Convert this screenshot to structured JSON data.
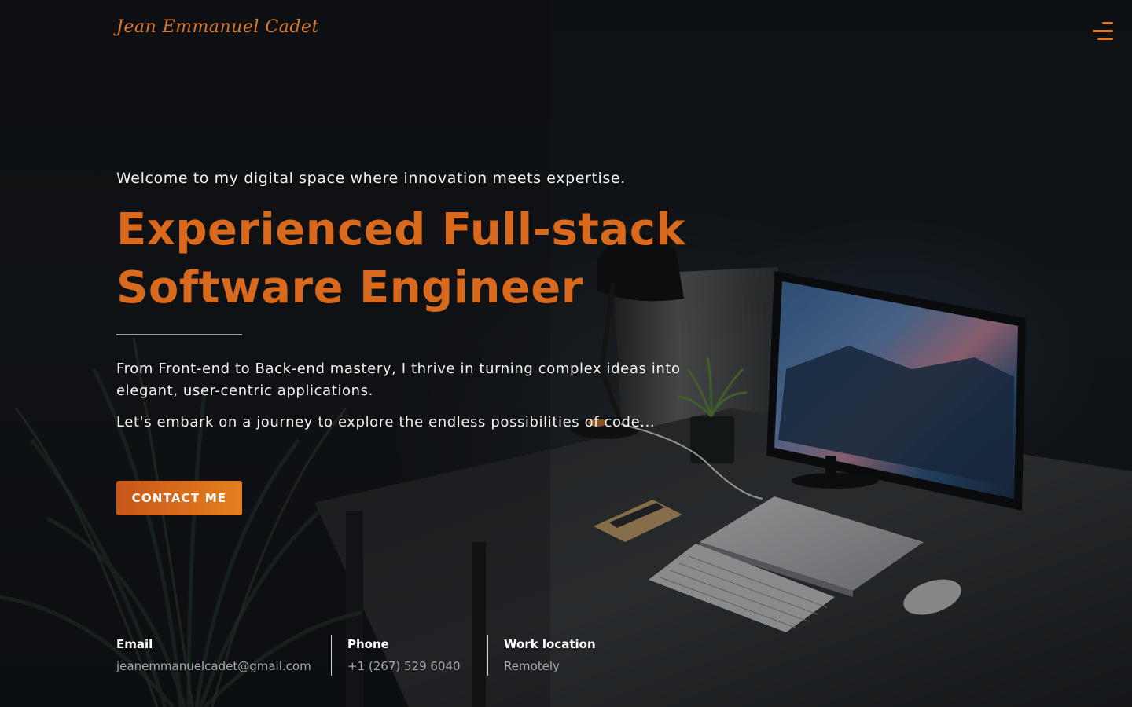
{
  "header": {
    "logo_text": "Jean Emmanuel Cadet",
    "menu_icon": "menu-icon"
  },
  "hero": {
    "intro": "Welcome to my digital space where innovation meets expertise.",
    "title_line1": "Experienced Full-stack",
    "title_line2": "Software Engineer",
    "description": "From Front-end to Back-end mastery, I thrive in turning complex ideas into elegant, user-centric applications.",
    "description2": "Let's embark on a journey to explore the endless possibilities of code...",
    "cta_label": "CONTACT ME"
  },
  "info": {
    "email_label": "Email",
    "email_value": "jeanemmanuelcadet@gmail.com",
    "phone_label": "Phone",
    "phone_value": "+1 (267) 529 6040",
    "work_label": "Work location",
    "work_value": "Remotely"
  },
  "colors": {
    "accent": "#d9691c",
    "button_start": "#c8561a",
    "button_end": "#e3801f",
    "background": "#121518",
    "text": "#f2f2f2",
    "muted": "#a6a9ad"
  }
}
